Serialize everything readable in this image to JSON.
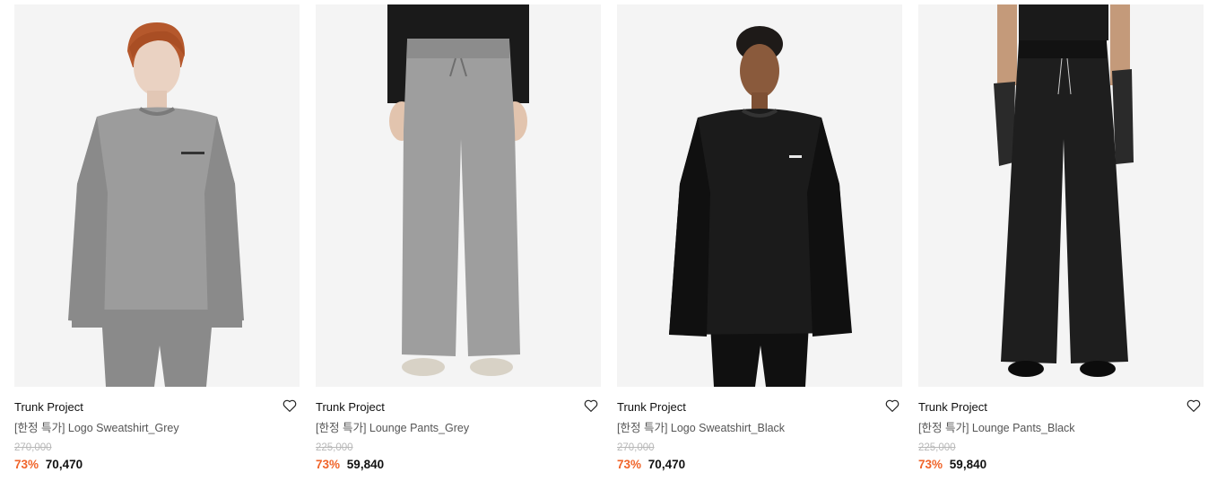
{
  "products": [
    {
      "brand": "Trunk Project",
      "name": "[한정 특가] Logo Sweatshirt_Grey",
      "original_price": "270,000",
      "discount": "73%",
      "price": "70,470",
      "image_kind": "sweatshirt",
      "garment_color": "#9c9c9c",
      "shade_color": "#8a8a8a",
      "wishlist_icon": "heart-outline-icon"
    },
    {
      "brand": "Trunk Project",
      "name": "[한정 특가] Lounge Pants_Grey",
      "original_price": "225,000",
      "discount": "73%",
      "price": "59,840",
      "image_kind": "pants",
      "garment_color": "#9e9e9e",
      "shade_color": "#8c8c8c",
      "wishlist_icon": "heart-outline-icon"
    },
    {
      "brand": "Trunk Project",
      "name": "[한정 특가] Logo Sweatshirt_Black",
      "original_price": "270,000",
      "discount": "73%",
      "price": "70,470",
      "image_kind": "sweatshirt",
      "garment_color": "#1b1b1b",
      "shade_color": "#101010",
      "wishlist_icon": "heart-outline-icon"
    },
    {
      "brand": "Trunk Project",
      "name": "[한정 특가] Lounge Pants_Black",
      "original_price": "225,000",
      "discount": "73%",
      "price": "59,840",
      "image_kind": "pants",
      "garment_color": "#1e1e1e",
      "shade_color": "#121212",
      "wishlist_icon": "heart-outline-icon"
    }
  ],
  "colors": {
    "discount": "#f0642a",
    "image_bg": "#f4f4f4",
    "strikethrough": "#b8b8b8"
  }
}
